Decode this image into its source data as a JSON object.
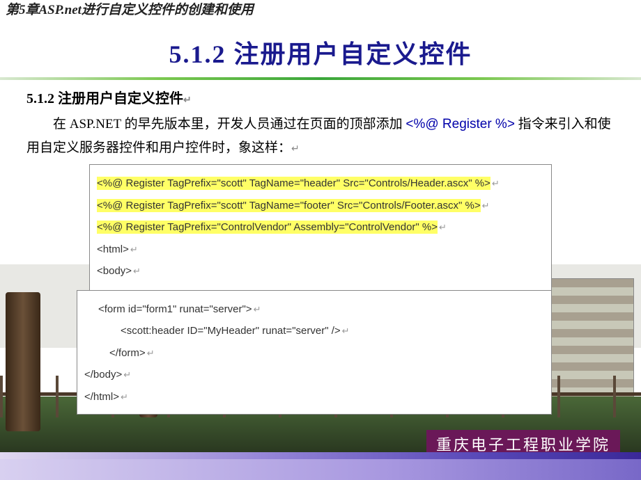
{
  "chapter": "第5章ASP.net进行自定义控件的创建和使用",
  "sectionHeader": "5.1.2 注册用户自定义控件",
  "subsectionTitle": "5.1.2 注册用户自定义控件",
  "subArrow": "↵",
  "paragraph": {
    "p1_pre": "在 ASP.NET 的早先版本里，开发人员通过在页面的顶部添加 ",
    "directive": "<%@ Register %>",
    "p1_post": " 指令来引入和使用自定义服务器控件和用户控件时，象这样：",
    "arrow": "↵"
  },
  "code1": {
    "l1": "<%@ Register TagPrefix=\"scott\" TagName=\"header\" Src=\"Controls/Header.ascx\" %>",
    "l2": "<%@ Register TagPrefix=\"scott\" TagName=\"footer\" Src=\"Controls/Footer.ascx\" %>",
    "l3": "<%@ Register TagPrefix=\"ControlVendor\" Assembly=\"ControlVendor\" %>",
    "l4": "<html>",
    "l5": "<body>",
    "arrow": "↵"
  },
  "code2": {
    "l1": "<form id=\"form1\" runat=\"server\">",
    "l2": "<scott:header ID=\"MyHeader\" runat=\"server\" />",
    "l3": "</form>",
    "l4": "</body>",
    "l5": "</html>",
    "arrow": "↵"
  },
  "school": "重庆电子工程职业学院"
}
